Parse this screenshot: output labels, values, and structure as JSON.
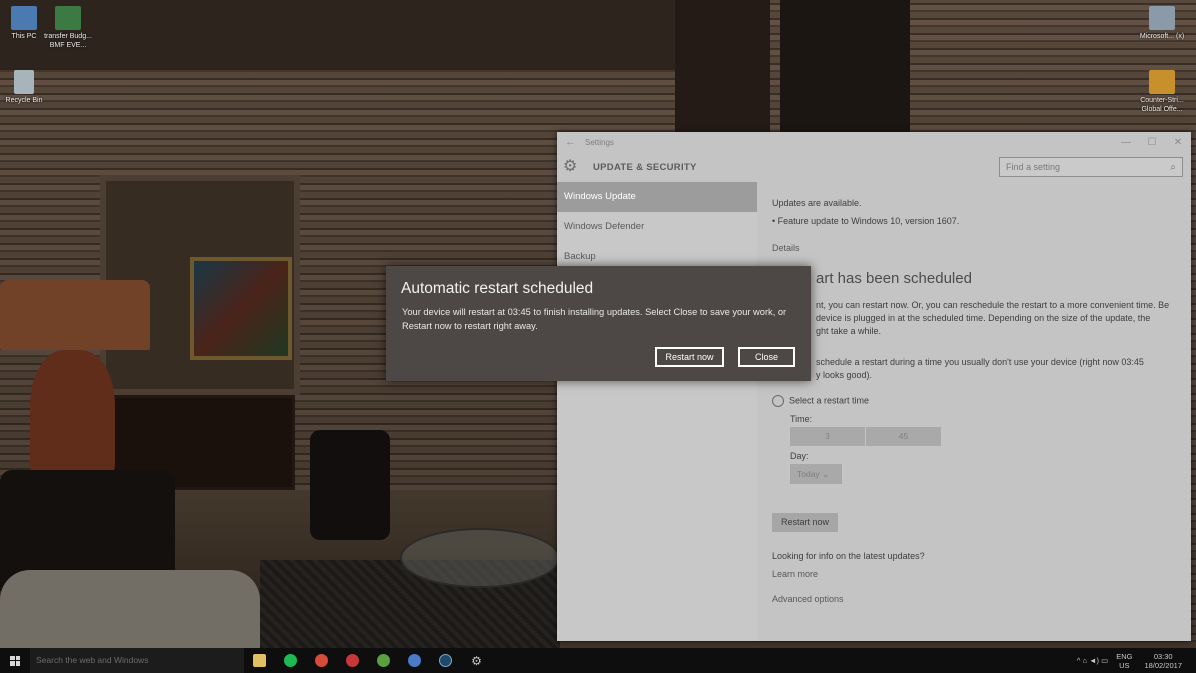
{
  "desktop": {
    "icons_left": [
      {
        "label": "This PC",
        "icon": "computer-icon",
        "color": "#4a7ab0"
      },
      {
        "label": "transfer Budg... BMF EVE...",
        "icon": "excel-file-icon",
        "color": "#3c7a44"
      },
      {
        "label": "Recycle Bin",
        "icon": "recycle-bin-icon",
        "color": "#a8b4bc"
      }
    ],
    "icons_right": [
      {
        "label": "Microsoft... (x)",
        "icon": "app-box-icon",
        "color": "#8a9aa8"
      },
      {
        "label": "Counter-Stri... Global Offe...",
        "icon": "csgo-icon",
        "color": "#c8902c"
      }
    ]
  },
  "settings": {
    "window_title": "Settings",
    "header_title": "UPDATE & SECURITY",
    "search_placeholder": "Find a setting",
    "nav": [
      "Windows Update",
      "Windows Defender",
      "Backup"
    ],
    "content": {
      "status": "Updates are available.",
      "update_item": "• Feature update to Windows 10, version 1607.",
      "details_link": "Details",
      "heading_partial": "art has been scheduled",
      "para1_line1": "nt, you can restart now. Or, you can reschedule the restart to a more convenient time. Be",
      "para1_line2": "device is plugged in at the scheduled time. Depending on the size of the update, the",
      "para1_line3": "ght take a while.",
      "para2_line1": "schedule a restart during a time you usually don't use your device (right now 03:45",
      "para2_line2": "y looks good).",
      "radio_label": "Select a restart time",
      "time_label": "Time:",
      "time_hour": "3",
      "time_minute": "45",
      "day_label": "Day:",
      "day_value": "Today",
      "restart_button": "Restart now",
      "info_text": "Looking for info on the latest updates?",
      "learn_more": "Learn more",
      "advanced": "Advanced options"
    }
  },
  "dialog": {
    "title": "Automatic restart scheduled",
    "message": "Your device will restart at 03:45 to finish installing updates. Select Close to save your work, or Restart now to restart right away.",
    "restart_button": "Restart now",
    "close_button": "Close"
  },
  "taskbar": {
    "search_placeholder": "Search the web and Windows",
    "pinned": [
      {
        "name": "file-explorer-icon",
        "color": "#e0c060"
      },
      {
        "name": "spotify-icon",
        "color": "#1db954"
      },
      {
        "name": "chrome-icon",
        "color": "#d84a3a"
      },
      {
        "name": "app-red-icon",
        "color": "#c8383a"
      },
      {
        "name": "app-green-icon",
        "color": "#5aa040"
      },
      {
        "name": "chrome-alt-icon",
        "color": "#4a7ac8"
      },
      {
        "name": "steam-icon",
        "color": "#1c4a6c"
      },
      {
        "name": "settings-gear-icon",
        "color": "#c8c8c8"
      }
    ],
    "tray_icons": "^ ⌂ ◄) ▭",
    "lang_top": "ENG",
    "lang_bottom": "US",
    "time": "03:30",
    "date": "18/02/2017"
  }
}
